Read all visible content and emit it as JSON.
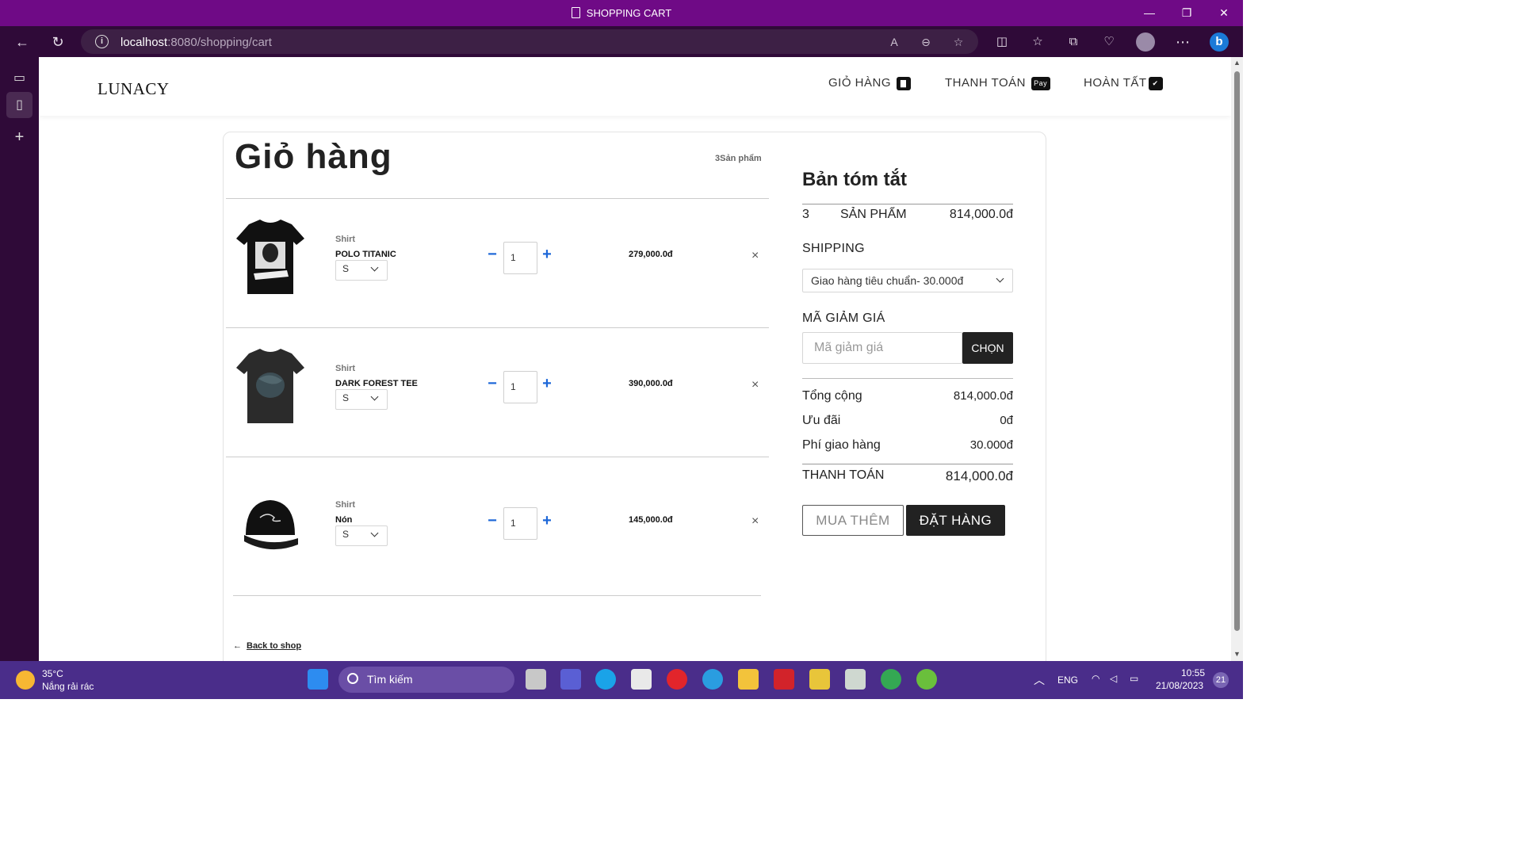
{
  "window": {
    "title": "SHOPPING CART",
    "minimize": "—",
    "restore": "❐",
    "close": "✕"
  },
  "browser": {
    "url_host": "localhost",
    "url_path": ":8080/shopping/cart",
    "back": "←",
    "reload": "↻"
  },
  "site": {
    "logo": "LUNACY",
    "nav": [
      {
        "label": "GIỎ HÀNG",
        "icon": "shopping-bag-icon"
      },
      {
        "label": "THANH TOÁN",
        "icon": "apple-pay-icon",
        "icon_text": "Pay"
      },
      {
        "label": "HOÀN TẤT",
        "icon": "checkbox-icon",
        "icon_text": "✔"
      }
    ]
  },
  "cart": {
    "title": "Giỏ hàng",
    "count": "3Sản phẩm",
    "items": [
      {
        "category": "Shirt",
        "name": "POLO TITANIC",
        "size": "S",
        "qty": "1",
        "price": "279,000.0đ",
        "image": "black-graphic-tshirt"
      },
      {
        "category": "Shirt",
        "name": "DARK FOREST TEE",
        "size": "S",
        "qty": "1",
        "price": "390,000.0đ",
        "image": "dark-forest-tshirt"
      },
      {
        "category": "Shirt",
        "name": "Nón",
        "size": "S",
        "qty": "1",
        "price": "145,000.0đ",
        "image": "black-cap"
      }
    ],
    "minus": "−",
    "plus": "+",
    "remove": "×",
    "back_arrow": "←",
    "back": "Back to shop"
  },
  "summary": {
    "title": "Bản tóm tắt",
    "items_count": "3",
    "items_label": "SẢN PHẨM",
    "items_total": "814,000.0đ",
    "shipping_label": "SHIPPING",
    "shipping_option": "Giao hàng tiêu chuẩn- 30.000đ",
    "coupon_label": "MÃ GIẢM GIÁ",
    "coupon_placeholder": "Mã giảm giá",
    "coupon_button": "CHỌN",
    "subtotal_label": "Tổng cộng",
    "subtotal": "814,000.0đ",
    "discount_label": "Ưu đãi",
    "discount": "0đ",
    "shipping_fee_label": "Phí giao hàng",
    "shipping_fee": "30.000đ",
    "pay_label": "THANH TOÁN",
    "pay_total": "814,000.0đ",
    "buy_more": "MUA THÊM",
    "order": "ĐẶT HÀNG"
  },
  "taskbar": {
    "temp": "35°C",
    "weather": "Nắng rải rác",
    "search": "Tìm kiếm",
    "lang": "ENG",
    "time": "10:55",
    "date": "21/08/2023",
    "notifications": "21"
  },
  "colors": {
    "titlebar": "#6f0a86",
    "accent": "#1d67d8",
    "dark_button": "#222222",
    "taskbar": "#4a2d8a"
  }
}
